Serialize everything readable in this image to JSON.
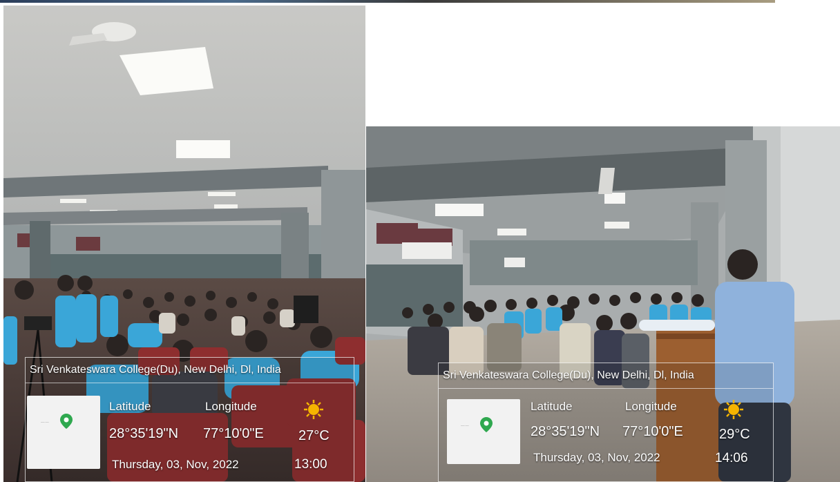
{
  "photos": [
    {
      "address": "Sri Venkateswara College(Du), New Delhi, Dl, India",
      "latitude_label": "Latitude",
      "longitude_label": "Longitude",
      "latitude": "28°35'19\"N",
      "longitude": "77°10'0\"E",
      "temperature": "27°C",
      "date": "Thursday, 03, Nov, 2022",
      "time": "13:00",
      "weather_icon": "sun-icon",
      "map_icon": "location-pin-icon"
    },
    {
      "address": "Sri Venkateswara College(Du), New Delhi, Dl, India",
      "latitude_label": "Latitude",
      "longitude_label": "Longitude",
      "latitude": "28°35'19\"N",
      "longitude": "77°10'0\"E",
      "temperature": "29°C",
      "date": "Thursday, 03, Nov, 2022",
      "time": "14:06",
      "weather_icon": "sun-icon",
      "map_icon": "location-pin-icon"
    }
  ],
  "colors": {
    "pin": "#2fa84f",
    "sun": "#f5b400",
    "shirt_blue": "#3aa6d8"
  }
}
